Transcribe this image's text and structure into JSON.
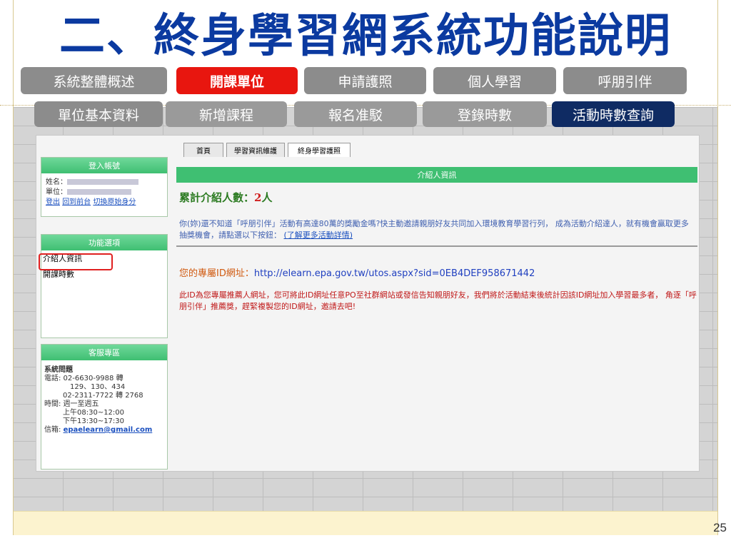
{
  "title": "二、終身學習網系統功能說明",
  "page_number": "25",
  "tabs_row1": [
    {
      "label": "系統整體概述"
    },
    {
      "label": "開課單位"
    },
    {
      "label": "申請護照"
    },
    {
      "label": "個人學習"
    },
    {
      "label": "呼朋引伴"
    }
  ],
  "tabs_row2": [
    {
      "label": "單位基本資料"
    },
    {
      "label": "新增課程"
    },
    {
      "label": "報名准駁"
    },
    {
      "label": "登錄時數"
    },
    {
      "label": "活動時數查詢"
    }
  ],
  "screenshot": {
    "browser_tabs": [
      "首頁",
      "學習資訊維護",
      "終身學習護照"
    ],
    "login": {
      "header": "登入帳號",
      "name_label": "姓名：",
      "unit_label": "單位：",
      "links": [
        "登出",
        "回到前台",
        "切換原始身分"
      ]
    },
    "functions": {
      "header": "功能選項",
      "items": [
        "介紹人資訊",
        "開課時數"
      ]
    },
    "service": {
      "header": "客服專區",
      "title": "系統問題",
      "lines": [
        "電話: 02-6630-9988 轉",
        "129、130、434",
        "02-2311-7722 轉 2768",
        "時間: 週一至週五",
        "上午08:30~12:00",
        "下午13:30~17:30"
      ],
      "email_label": "信箱:",
      "email": "epaelearn@gmail.com"
    },
    "main": {
      "bar_title": "介紹人資訊",
      "count_label": "累計介紹人數：",
      "count_value": "2",
      "count_unit": "人",
      "intro_text": "你(妳)還不知道「呼朋引伴」活動有高達80萬的獎勵金嗎?快主動邀請親朋好友共同加入環境教育學習行列， 成為活動介紹達人，就有機會贏取更多抽獎機會，請點選以下按鈕：",
      "intro_link": "(了解更多活動詳情)",
      "url_label": "您的專屬ID網址：",
      "url": "http://elearn.epa.gov.tw/utos.aspx?sid=0EB4DEF958671442",
      "warn_text": "此ID為您專屬推薦人網址，您可將此ID網址任意PO至社群網站或發信告知親朋好友，我們將於活動結束後統計因該ID網址加入學習最多者， 角逐「呼朋引伴」推薦獎，趕緊複製您的ID網址，邀請去吧!"
    }
  },
  "colors": {
    "title": "#0b3aa0",
    "active_tab": "#e8160f",
    "dark_tab": "#0f2b63",
    "gray_tab": "#8c8c8c",
    "green_bar": "#3fbf72"
  }
}
